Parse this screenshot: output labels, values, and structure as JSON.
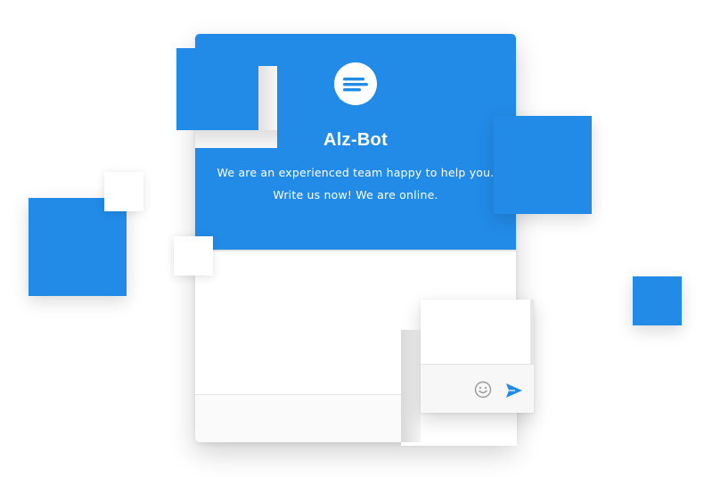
{
  "widget": {
    "bot_name": "Alz-Bot",
    "description_line1": "We are an experienced team happy to help you.",
    "description_line2": "Write us now! We are online.",
    "logo_icon": "chat-bubble-icon"
  },
  "composer": {
    "emoji_icon": "smiley-icon",
    "send_icon": "send-icon"
  },
  "colors": {
    "accent": "#228be7",
    "background": "#ffffff",
    "composer_bg": "#f7f7f7"
  }
}
